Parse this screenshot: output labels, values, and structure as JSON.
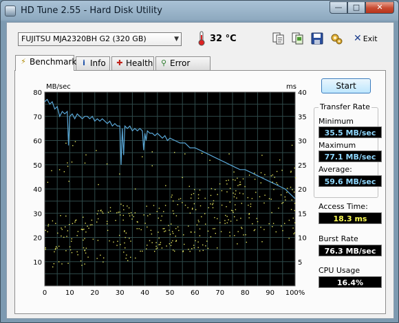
{
  "window": {
    "title": "HD Tune 2.55 - Hard Disk Utility"
  },
  "toolbar": {
    "drive": "FUJITSU MJA2320BH G2 (320 GB)",
    "temperature": "32 °C",
    "exit_label": "Exit",
    "icons": [
      "copy-text-icon",
      "copy-screen-icon",
      "save-icon",
      "options-icon"
    ]
  },
  "tabs": [
    {
      "label": "Benchmark",
      "active": true,
      "icon": "benchmark-icon"
    },
    {
      "label": "Info",
      "active": false,
      "icon": "info-icon"
    },
    {
      "label": "Health",
      "active": false,
      "icon": "health-icon"
    },
    {
      "label": "Error Scan",
      "active": false,
      "icon": "error-scan-icon"
    }
  ],
  "benchmark": {
    "start_label": "Start",
    "transfer_rate_title": "Transfer Rate",
    "minimum_label": "Minimum",
    "minimum_value": "35.5 MB/sec",
    "maximum_label": "Maximum",
    "maximum_value": "77.1 MB/sec",
    "average_label": "Average:",
    "average_value": "59.6 MB/sec",
    "access_time_label": "Access Time:",
    "access_time_value": "18.3 ms",
    "burst_rate_label": "Burst Rate",
    "burst_rate_value": "76.3 MB/sec",
    "cpu_usage_label": "CPU Usage",
    "cpu_usage_value": "16.4%"
  },
  "colors": {
    "plot_bg": "#000000",
    "grid": "#2f4a4a",
    "transfer_line": "#5aa8d8",
    "access_points": "#e8e860",
    "value_blue": "#8fd8ff",
    "value_yellow": "#ffff55"
  },
  "chart_data": {
    "type": "line",
    "left_axis_label": "MB/sec",
    "right_axis_label": "ms",
    "x_ticks": [
      "0",
      "10",
      "20",
      "30",
      "40",
      "50",
      "60",
      "70",
      "80",
      "90",
      "100%"
    ],
    "y_left_ticks": [
      "10",
      "20",
      "30",
      "40",
      "50",
      "60",
      "70",
      "80"
    ],
    "y_right_ticks": [
      "5",
      "10",
      "15",
      "20",
      "25",
      "30",
      "35",
      "40"
    ],
    "xlim": [
      0,
      100
    ],
    "ylim_left": [
      0,
      80
    ],
    "ylim_right": [
      0,
      40
    ],
    "grid": true,
    "transfer_rate": {
      "x": [
        0,
        1,
        2,
        3,
        4,
        5,
        6,
        7,
        8,
        9,
        9.5,
        10,
        11,
        12,
        13,
        14,
        15,
        16,
        17,
        18,
        19,
        20,
        21,
        22,
        23,
        24,
        25,
        26,
        27,
        28,
        29,
        30,
        30.5,
        31,
        31.5,
        32,
        33,
        34,
        35,
        36,
        37,
        38,
        39,
        39.5,
        40,
        40.5,
        41,
        42,
        43,
        44,
        45,
        46,
        47,
        48,
        49,
        50,
        52,
        54,
        56,
        58,
        60,
        62,
        64,
        66,
        68,
        70,
        72,
        74,
        76,
        78,
        80,
        82,
        84,
        86,
        88,
        90,
        92,
        94,
        96,
        98,
        100
      ],
      "y": [
        76,
        77,
        75,
        76,
        73,
        74,
        70,
        72,
        71,
        72,
        58,
        70,
        71,
        69,
        71,
        70,
        69,
        70,
        70,
        69,
        70,
        68,
        69,
        68,
        69,
        68,
        67,
        68,
        66,
        67,
        66,
        66,
        50,
        65,
        54,
        66,
        65,
        66,
        64,
        65,
        64,
        65,
        64,
        56,
        63,
        60,
        64,
        63,
        63,
        62,
        63,
        62,
        61,
        62,
        60,
        61,
        60,
        59,
        59,
        57,
        57,
        56,
        55,
        54,
        53,
        52,
        51,
        50,
        49,
        48,
        48,
        47,
        46,
        45,
        44,
        43,
        42,
        41,
        40,
        38,
        36
      ]
    },
    "access_time": {
      "ms_range_at_start": [
        3,
        14
      ],
      "ms_range_at_end": [
        10,
        25
      ],
      "point_count": 420
    }
  }
}
